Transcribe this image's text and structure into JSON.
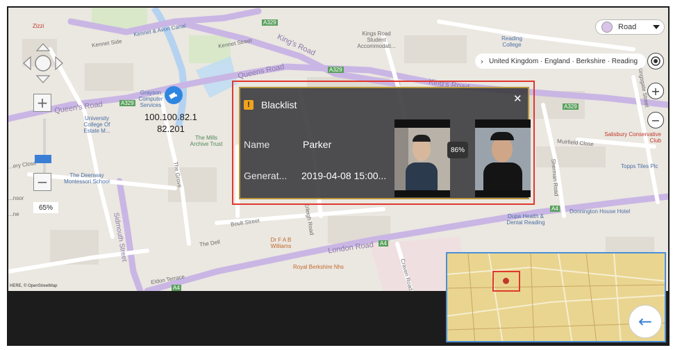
{
  "map_labels": {
    "zizzi": "Zizzi",
    "kennet_side": "Kennet Side",
    "kennet_avon": "Kennet & Avon Canal",
    "kennet_street": "Kennet Street",
    "kings_road_top": "King's Road",
    "a329_a": "A329",
    "a329_b": "A329",
    "a329_c": "A329",
    "a329_d": "A329",
    "kings_road_student": "Kings Road Student Accommodati...",
    "reading_college": "Reading College",
    "queens_road_left": "Queen's Road",
    "queens_road_mid": "Queens Road",
    "kings_road_right": "King's Road",
    "grayson": "Grayson Computer Services",
    "university_college": "University College Of Estate M...",
    "deenway": "The Deenway Montessori School",
    "the_grove": "The Grove",
    "the_mills": "The Mills Archive Trust",
    "sidmouth": "Sidmouth Street",
    "boults": "Boult Street",
    "the_dell": "The Dell",
    "dr_fab": "Dr F A B Williams",
    "london_road": "London Road",
    "a4_a": "A4",
    "a4_b": "A4",
    "a4_c": "A4",
    "royal_berkshire": "Royal Berkshire Nhs",
    "eldon_terrace": "Eldon Terrace",
    "craven_road": "Craven Road",
    "muirfield": "Muirfield Close",
    "salisbury": "Salisbury Conservative Club",
    "topps_tiles": "Topps Tiles Plc",
    "donnington": "Donnington House Hotel",
    "dupa": "Dupa Health & Dental Reading",
    "kingsgate": "Kingsgate Street",
    "sherman": "Sherman Road",
    "erleigh": "Erleigh Road",
    "avery": "...ery Close",
    "a4_sign": "A4",
    "a329_sign": "A329",
    "bar_left": "...nsor",
    "bar_left2": "...ne",
    "attribution": "HERE, © OpenStreetMap"
  },
  "map_layer": {
    "label": "Road"
  },
  "breadcrumb": {
    "text": "United Kingdom · England · Berkshire · Reading"
  },
  "zoom": {
    "percent_label": "65%",
    "level": 0.65
  },
  "camera": {
    "ip_line1": "100.100.82.1",
    "ip_line2": "82.201"
  },
  "popup": {
    "title": "Blacklist",
    "close": "✕",
    "name_label": "Name",
    "name_value": "Parker",
    "time_label": "Generat...",
    "time_value": "2019-04-08 15:00...",
    "match": "86%"
  },
  "controls": {
    "plus": "+",
    "minus": "−",
    "back": "←"
  },
  "colors": {
    "alarm_frame": "#e0382d",
    "accent": "#3a7fd5",
    "warning": "#f0a31c",
    "road_purple": "#c9b6e4"
  }
}
